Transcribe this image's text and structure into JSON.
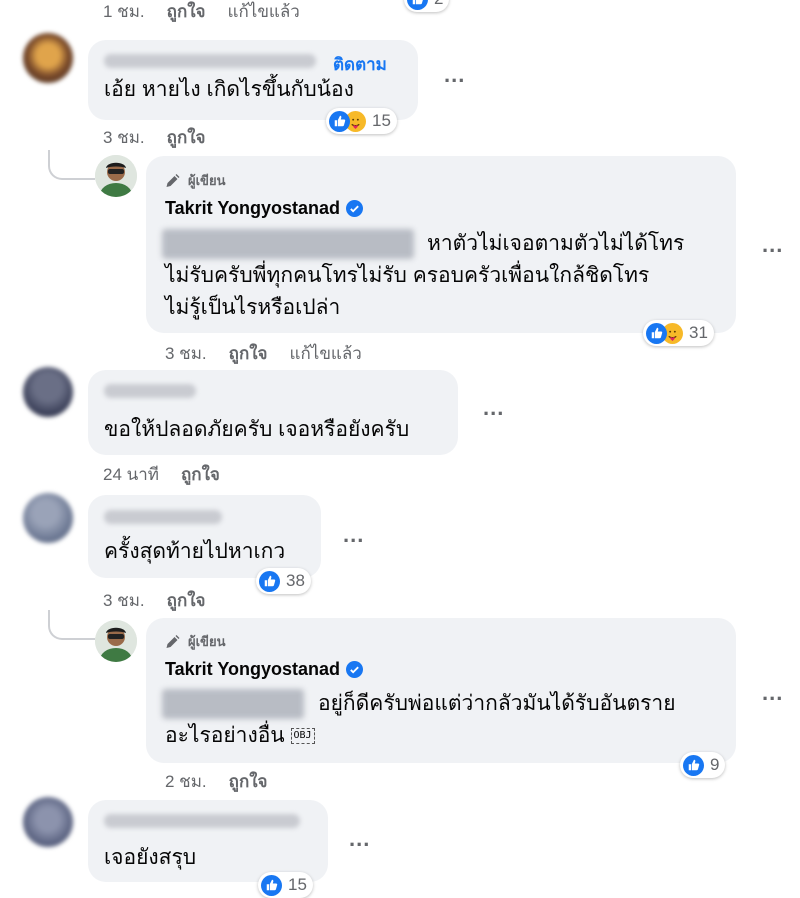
{
  "top": {
    "time": "1 ชม.",
    "like": "ถูกใจ",
    "edited": "แก้ไขแล้ว",
    "reaction_count": "2"
  },
  "comments": [
    {
      "follow_label": "ติดตาม",
      "text": "เอ้ย หายไง เกิดไรขึ้นกับน้อง",
      "time": "3 ชม.",
      "like": "ถูกใจ",
      "reaction_count": "15"
    },
    {
      "author_badge": "ผู้เขียน",
      "author_name": "Takrit Yongyostanad",
      "line1": "หาตัวไม่เจอตามตัวไม่ได้โทร",
      "line2": "ไม่รับครับพี่ทุกคนโทรไม่รับ ครอบครัวเพื่อนใกล้ชิดโทร",
      "line3": "ไม่รู้เป็นไรหรือเปล่า",
      "time": "3 ชม.",
      "like": "ถูกใจ",
      "edited": "แก้ไขแล้ว",
      "reaction_count": "31"
    },
    {
      "text": "ขอให้ปลอดภัยครับ เจอหรือยังครับ",
      "time": "24 นาที",
      "like": "ถูกใจ"
    },
    {
      "text": "ครั้งสุดท้ายไปหาเกว",
      "time": "3 ชม.",
      "like": "ถูกใจ",
      "reaction_count": "38"
    },
    {
      "author_badge": "ผู้เขียน",
      "author_name": "Takrit Yongyostanad",
      "line1": "อยู่ก็ดีครับพ่อแต่ว่ากลัวมันได้รับอันตราย",
      "line2": "อะไรอย่างอื่น",
      "obj": "OBJ",
      "time": "2 ชม.",
      "like": "ถูกใจ",
      "reaction_count": "9"
    },
    {
      "text": "เจอยังสรุบ",
      "reaction_count": "15"
    }
  ],
  "more_label": "...",
  "colors": {
    "accent": "#1877f2",
    "bubble": "#f0f2f5",
    "meta": "#65676b"
  }
}
